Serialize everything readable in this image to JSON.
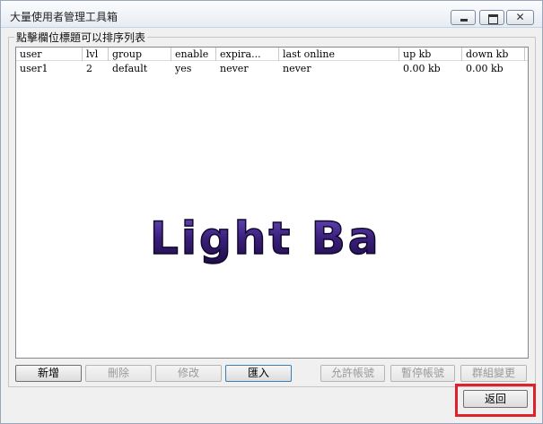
{
  "window": {
    "title": "大量使用者管理工具箱",
    "close_glyph": "✕"
  },
  "group": {
    "title": "點擊欄位標題可以排序列表"
  },
  "table": {
    "columns": [
      "user",
      "lvl",
      "group",
      "enable",
      "expira...",
      "last online",
      "up kb",
      "down kb"
    ],
    "rows": [
      [
        "user1",
        "2",
        "default",
        "yes",
        "never",
        "never",
        "0.00 kb",
        "0.00 kb"
      ]
    ]
  },
  "logo": {
    "text": "Light Bar",
    "color": "#3a1f7a"
  },
  "buttons": {
    "add": "新增",
    "delete": "刪除",
    "edit": "修改",
    "import": "匯入",
    "allow": "允許帳號",
    "suspend": "暫停帳號",
    "group_change": "群組變更",
    "back": "返回"
  },
  "colors": {
    "highlight": "#e0202a",
    "logo_fill": "#3a1f7a"
  }
}
